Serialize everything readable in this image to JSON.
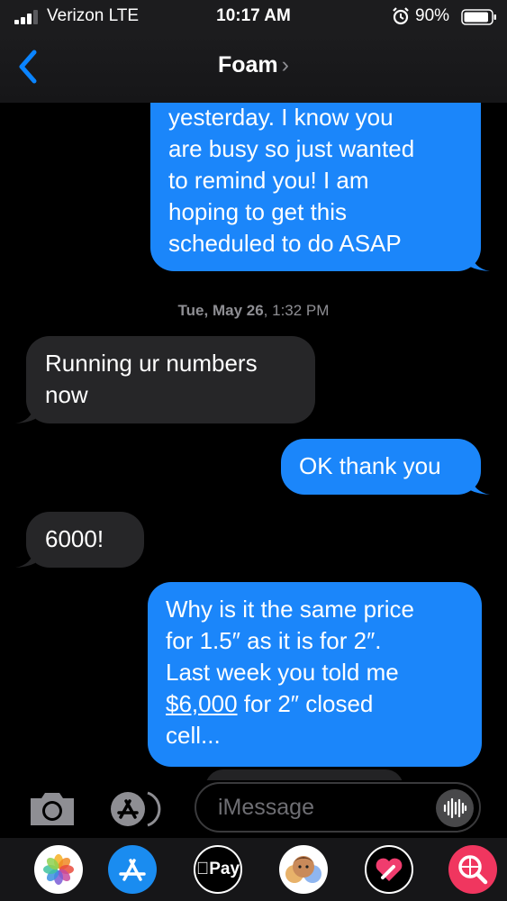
{
  "status": {
    "carrier": "Verizon  LTE",
    "time": "10:17 AM",
    "battery": "90%"
  },
  "header": {
    "back_icon": "chevron-left-icon",
    "title": "Foam",
    "chevron": "›"
  },
  "messages": [
    {
      "direction": "outgoing",
      "text": "yesterday. I know you\nare busy so just wanted\nto remind you! I am\nhoping to get this\nscheduled to do ASAP"
    },
    {
      "direction": "incoming",
      "text": "Running ur numbers\nnow"
    },
    {
      "direction": "outgoing",
      "text": "OK thank you"
    },
    {
      "direction": "incoming",
      "text": "6000!"
    },
    {
      "direction": "outgoing",
      "line1": "Why is it the same price\nfor 1.5″ as it is for 2″.\nLast week you told me",
      "link": "$6,000",
      "rest": " for 2″ closed\ncell..."
    }
  ],
  "timestamp": {
    "date": "Tue, May 26",
    "time": ", 1:32 PM"
  },
  "compose": {
    "placeholder": "iMessage"
  },
  "app_strip": {
    "pay_label": "Pay",
    "apple_glyph": "",
    "icons": [
      "photos-icon",
      "app-store-icon",
      "apple-pay-icon",
      "memoji-icon",
      "digital-touch-icon",
      "search-images-icon"
    ]
  },
  "colors": {
    "outgoing": "#1b86fa",
    "incoming": "#262628",
    "accent": "#0a84ff"
  }
}
